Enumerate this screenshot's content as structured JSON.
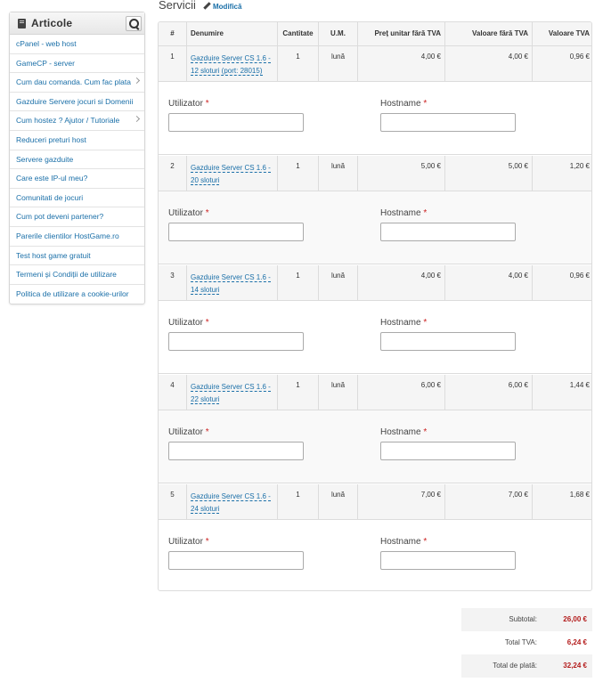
{
  "sidebar": {
    "title": "Articole",
    "items": [
      {
        "label": "cPanel - web host",
        "chevron": false
      },
      {
        "label": "GameCP - server",
        "chevron": false
      },
      {
        "label": "Cum dau comanda. Cum fac plata",
        "chevron": true
      },
      {
        "label": "Gazduire Servere jocuri si Domenii",
        "chevron": false
      },
      {
        "label": "Cum hostez ? Ajutor / Tutoriale",
        "chevron": true
      },
      {
        "label": "Reduceri preturi host",
        "chevron": false
      },
      {
        "label": "Servere gazduite",
        "chevron": false
      },
      {
        "label": "Care este IP-ul meu?",
        "chevron": false
      },
      {
        "label": "Comunitati de jocuri",
        "chevron": false
      },
      {
        "label": "Cum pot deveni partener?",
        "chevron": false
      },
      {
        "label": "Parerile clientilor HostGame.ro",
        "chevron": false
      },
      {
        "label": "Test host game gratuit",
        "chevron": false
      },
      {
        "label": "Termeni și Condiții de utilizare",
        "chevron": false
      },
      {
        "label": "Politica de utilizare a cookie-urilor",
        "chevron": false
      }
    ]
  },
  "header": {
    "title": "Servicii",
    "edit_label": "Modifică"
  },
  "table": {
    "columns": [
      "#",
      "Denumire",
      "Cantitate",
      "U.M.",
      "Preț unitar fără TVA",
      "Valoare fără TVA",
      "Valoare TVA"
    ],
    "form_labels": {
      "user": "Utilizator",
      "host": "Hostname",
      "required": "*"
    },
    "rows": [
      {
        "num": "1",
        "name_l1": "Gazduire Server CS 1.6 -",
        "name_l2": "12 sloturi (port: 28015)",
        "qty": "1",
        "um": "lună",
        "unit": "4,00 €",
        "value": "4,00 €",
        "vat": "0,96 €",
        "user": "",
        "host": ""
      },
      {
        "num": "2",
        "name_l1": "Gazduire Server CS 1.6 -",
        "name_l2": "20 sloturi",
        "qty": "1",
        "um": "lună",
        "unit": "5,00 €",
        "value": "5,00 €",
        "vat": "1,20 €",
        "user": "",
        "host": ""
      },
      {
        "num": "3",
        "name_l1": "Gazduire Server CS 1.6 -",
        "name_l2": "14 sloturi",
        "qty": "1",
        "um": "lună",
        "unit": "4,00 €",
        "value": "4,00 €",
        "vat": "0,96 €",
        "user": "",
        "host": ""
      },
      {
        "num": "4",
        "name_l1": "Gazduire Server CS 1.6 -",
        "name_l2": "22 sloturi",
        "qty": "1",
        "um": "lună",
        "unit": "6,00 €",
        "value": "6,00 €",
        "vat": "1,44 €",
        "user": "",
        "host": ""
      },
      {
        "num": "5",
        "name_l1": "Gazduire Server CS 1.6 -",
        "name_l2": "24 sloturi",
        "qty": "1",
        "um": "lună",
        "unit": "7,00 €",
        "value": "7,00 €",
        "vat": "1,68 €",
        "user": "",
        "host": ""
      }
    ]
  },
  "totals": {
    "subtotal_label": "Subtotal:",
    "subtotal": "26,00 €",
    "vat_label": "Total TVA:",
    "vat": "6,24 €",
    "total_label": "Total de plată:",
    "total": "32,24 €"
  },
  "colors": {
    "link": "#1a6fa8",
    "required": "#cc2222",
    "total_value": "#b31b1b"
  }
}
